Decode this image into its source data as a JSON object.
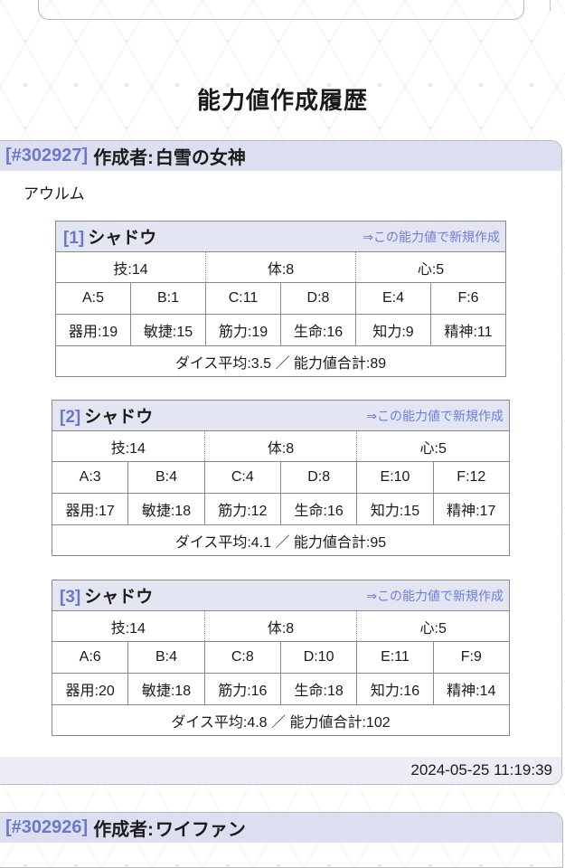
{
  "page": {
    "title": "能力値作成履歴"
  },
  "entries": [
    {
      "id": "[#302927]",
      "author_label": "作成者:",
      "author": "白雪の女神",
      "race": "アウルム",
      "timestamp": "2024-05-25 11:19:39",
      "rolls": [
        {
          "no": "[1]",
          "name": "シャドウ",
          "link": "⇒この能力値で新規作成",
          "groups": [
            "技:14",
            "体:8",
            "心:5"
          ],
          "dice": [
            "A:5",
            "B:1",
            "C:11",
            "D:8",
            "E:4",
            "F:6"
          ],
          "derived": [
            "器用:19",
            "敏捷:15",
            "筋力:19",
            "生命:16",
            "知力:9",
            "精神:11"
          ],
          "total": "ダイス平均:3.5 ／ 能力値合計:89"
        },
        {
          "no": "[2]",
          "name": "シャドウ",
          "link": "⇒この能力値で新規作成",
          "groups": [
            "技:14",
            "体:8",
            "心:5"
          ],
          "dice": [
            "A:3",
            "B:4",
            "C:4",
            "D:8",
            "E:10",
            "F:12"
          ],
          "derived": [
            "器用:17",
            "敏捷:18",
            "筋力:12",
            "生命:16",
            "知力:15",
            "精神:17"
          ],
          "total": "ダイス平均:4.1 ／ 能力値合計:95"
        },
        {
          "no": "[3]",
          "name": "シャドウ",
          "link": "⇒この能力値で新規作成",
          "groups": [
            "技:14",
            "体:8",
            "心:5"
          ],
          "dice": [
            "A:6",
            "B:4",
            "C:8",
            "D:10",
            "E:11",
            "F:9"
          ],
          "derived": [
            "器用:20",
            "敏捷:18",
            "筋力:16",
            "生命:18",
            "知力:16",
            "精神:14"
          ],
          "total": "ダイス平均:4.8 ／ 能力値合計:102"
        }
      ]
    },
    {
      "id": "[#302926]",
      "author_label": "作成者:",
      "author": "ワイファン"
    }
  ]
}
